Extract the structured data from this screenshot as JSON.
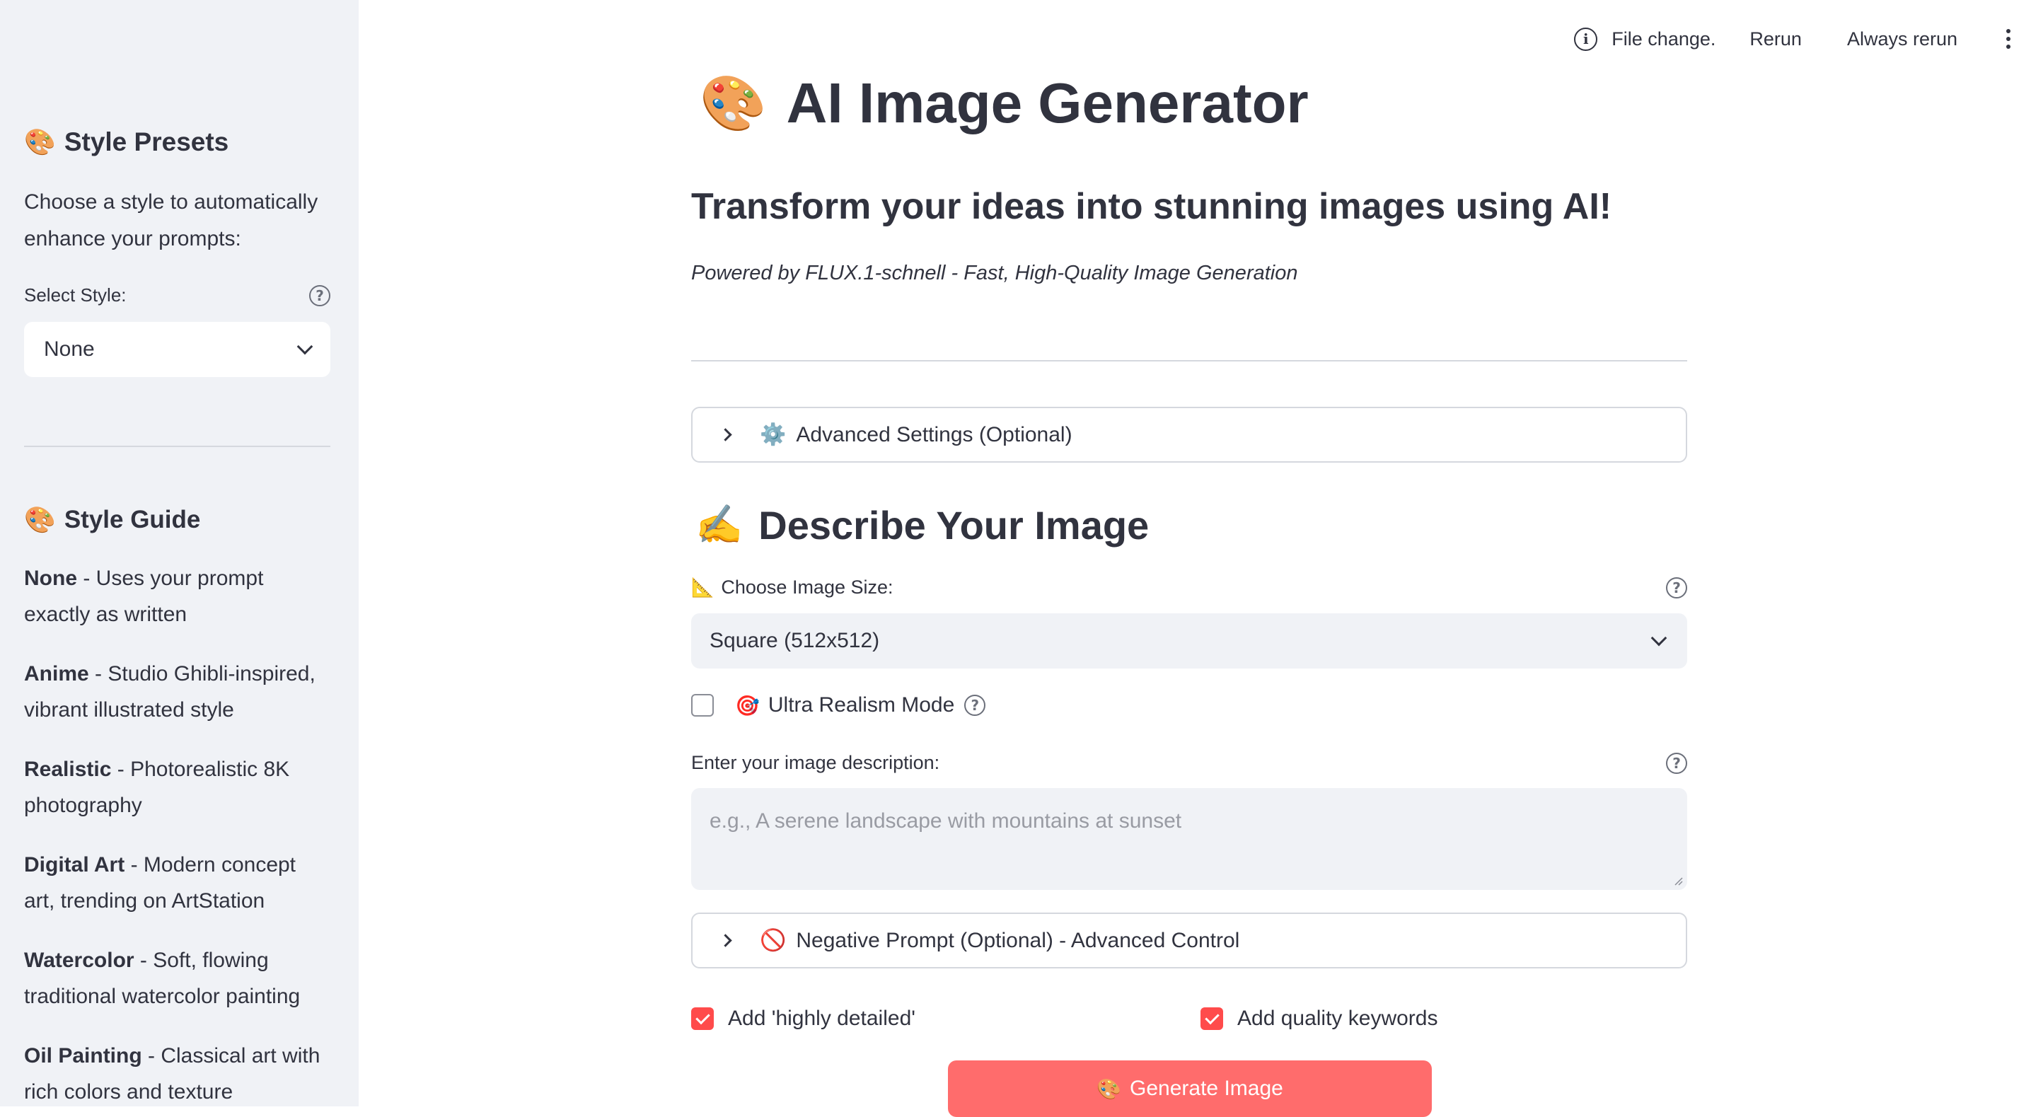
{
  "toolbar": {
    "status": "File change.",
    "rerun": "Rerun",
    "always_rerun": "Always rerun",
    "icons": [
      "info-icon",
      "kebab-menu-icon"
    ]
  },
  "sidebar": {
    "presets_emoji": "🎨",
    "presets_title": "Style Presets",
    "presets_desc": "Choose a style to automatically enhance your prompts:",
    "select_label": "Select Style:",
    "select_value": "None",
    "guide_emoji": "🎨",
    "guide_title": "Style Guide",
    "guide": [
      {
        "name": "None",
        "desc": " - Uses your prompt exactly as written"
      },
      {
        "name": "Anime",
        "desc": " - Studio Ghibli-inspired, vibrant illustrated style"
      },
      {
        "name": "Realistic",
        "desc": " - Photorealistic 8K photography"
      },
      {
        "name": "Digital Art",
        "desc": " - Modern concept art, trending on ArtStation"
      },
      {
        "name": "Watercolor",
        "desc": " - Soft, flowing traditional watercolor painting"
      },
      {
        "name": "Oil Painting",
        "desc": " - Classical art with rich colors and texture"
      }
    ]
  },
  "main": {
    "title_emoji": "🎨",
    "title": "AI Image Generator",
    "subtitle": "Transform your ideas into stunning images using AI!",
    "powered_by": "Powered by FLUX.1-schnell - Fast, High-Quality Image Generation",
    "advanced": {
      "emoji": "⚙️",
      "label": "Advanced Settings (Optional)"
    },
    "describe_emoji": "✍️",
    "describe_title": "Describe Your Image",
    "size": {
      "emoji": "📐",
      "label": "Choose Image Size:",
      "value": "Square (512x512)"
    },
    "ultra": {
      "emoji": "🎯",
      "label": "Ultra Realism Mode",
      "checked": false
    },
    "description": {
      "label": "Enter your image description:",
      "placeholder": "e.g., A serene landscape with mountains at sunset"
    },
    "negative": {
      "emoji": "🚫",
      "label": "Negative Prompt (Optional) - Advanced Control"
    },
    "highly_detailed": {
      "label": "Add 'highly detailed'",
      "checked": true
    },
    "quality_keywords": {
      "label": "Add quality keywords",
      "checked": true
    },
    "generate": {
      "emoji": "🎨",
      "label": "Generate Image"
    }
  },
  "colors": {
    "accent": "#ff4b4b",
    "button": "#ff6c6c",
    "sidebar_bg": "#f0f2f6",
    "text": "#31333f"
  }
}
